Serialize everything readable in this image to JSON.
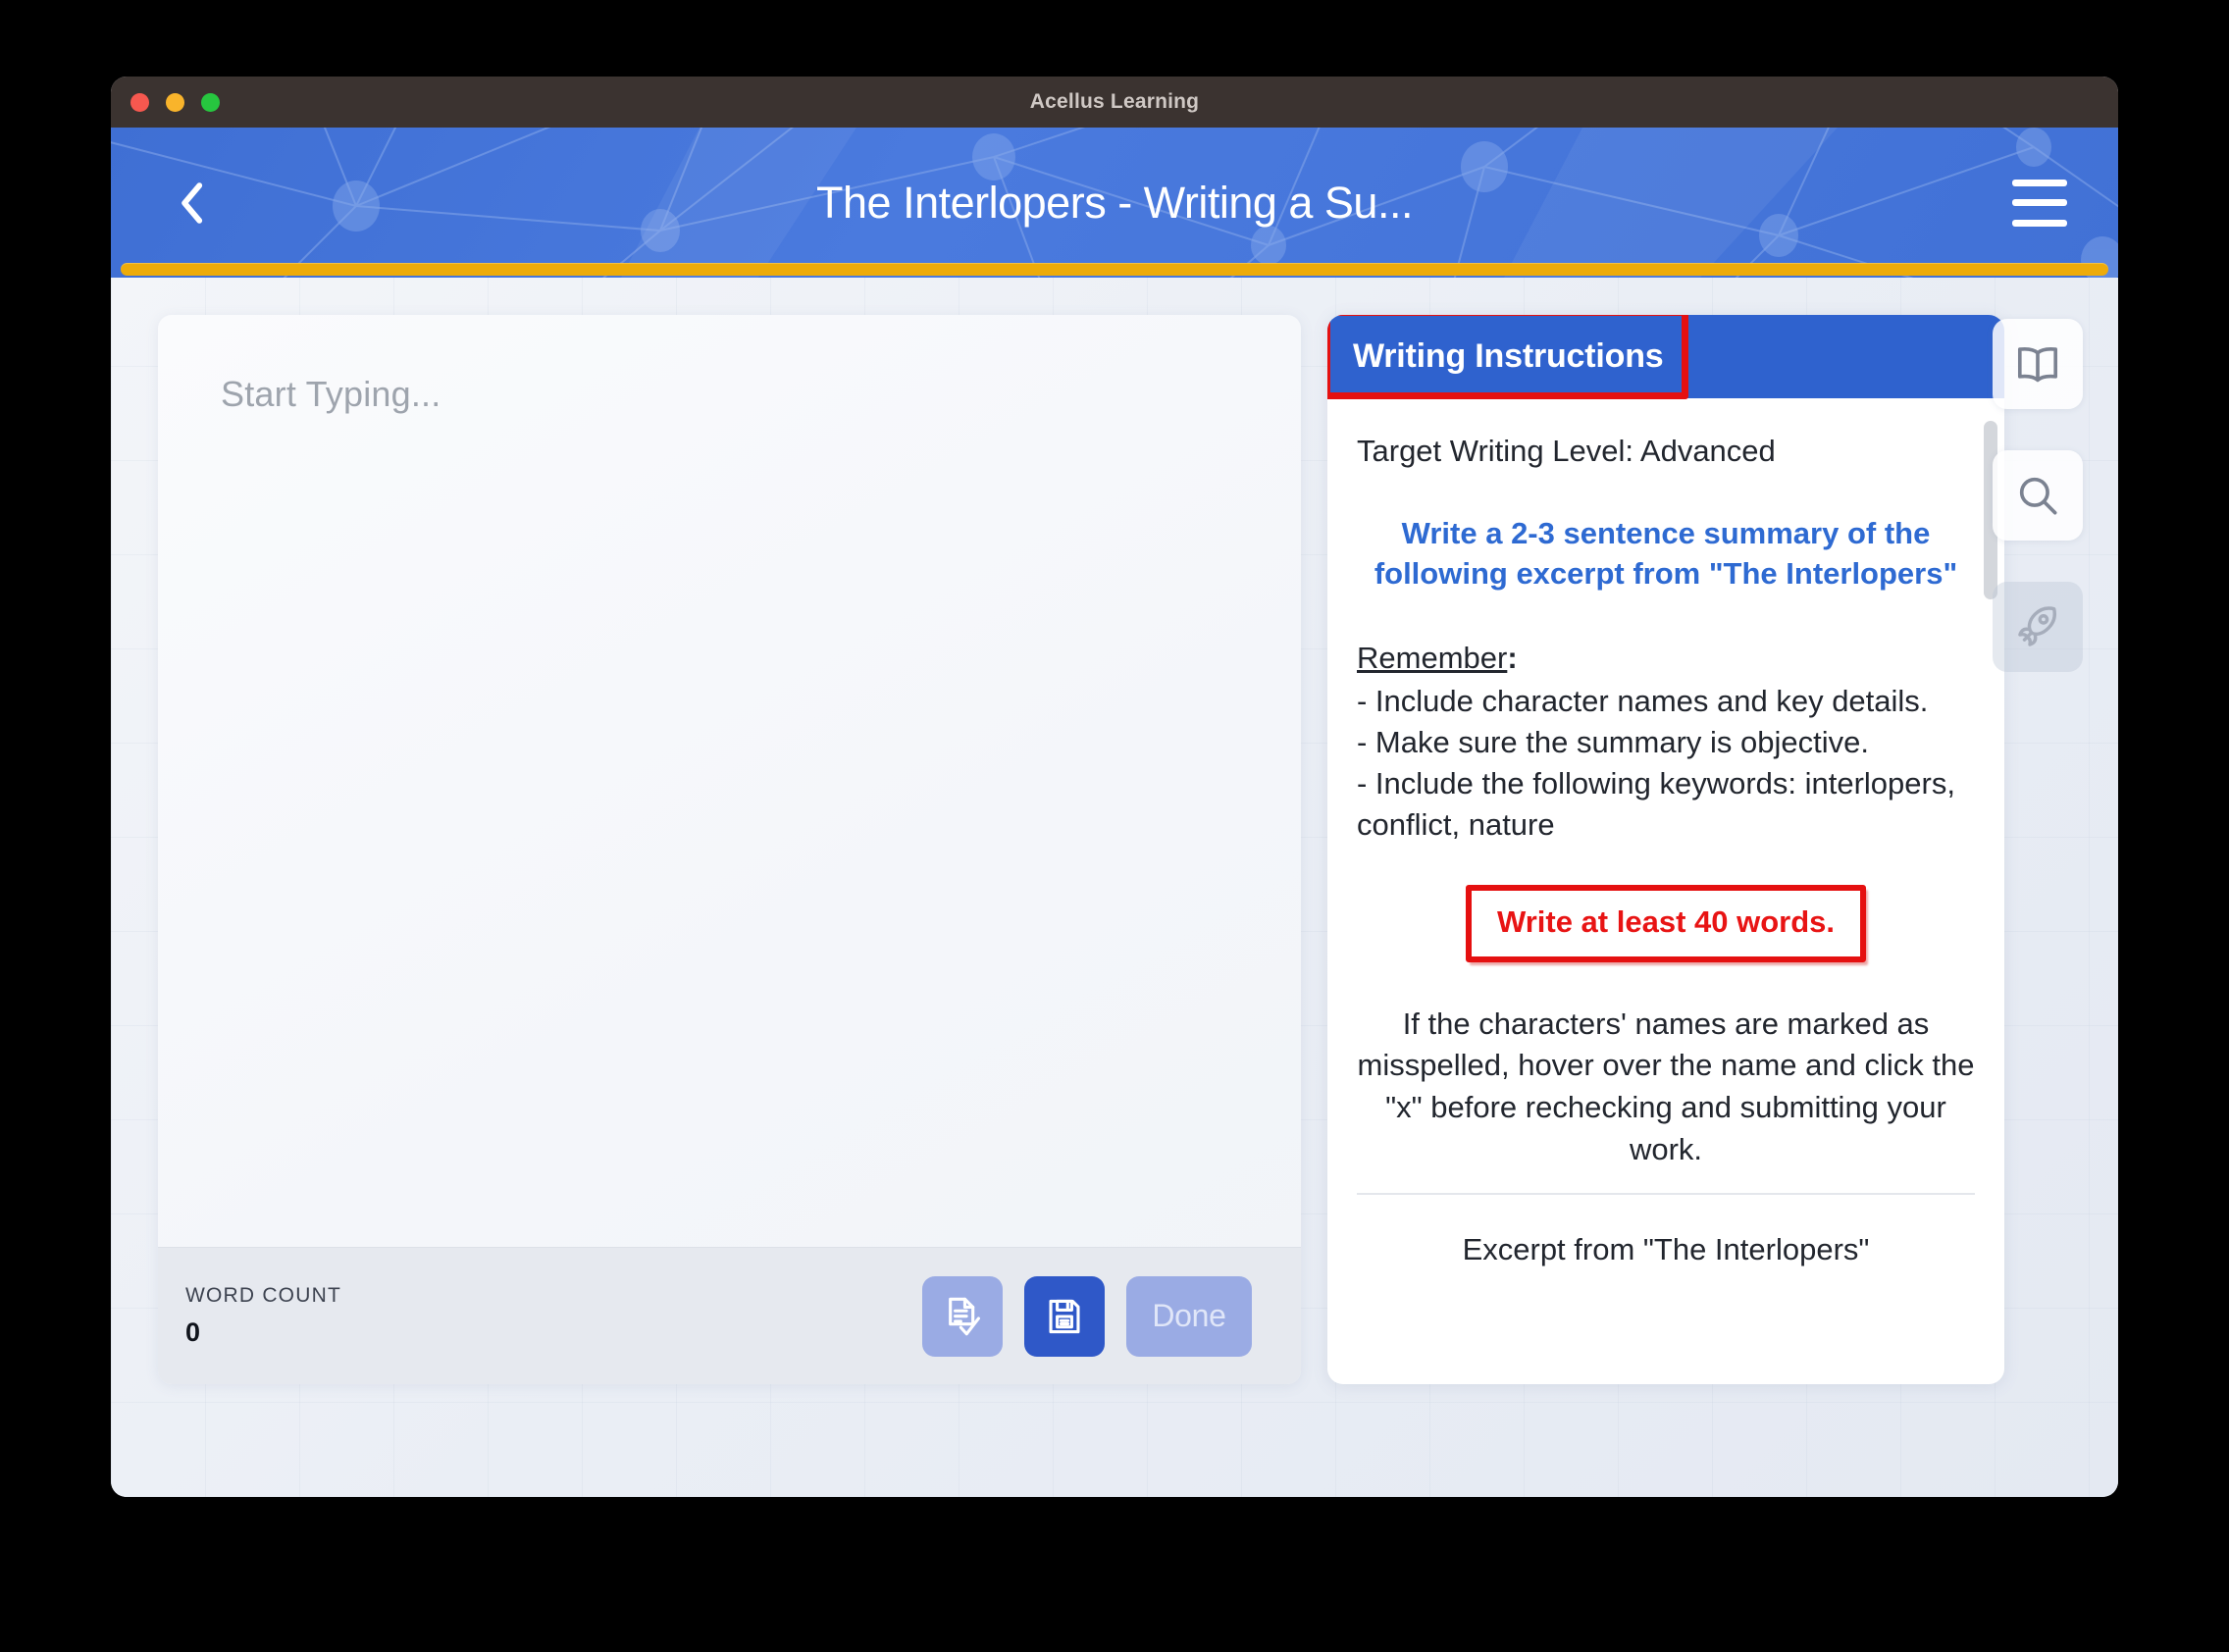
{
  "window": {
    "app_title": "Acellus Learning",
    "traffic_lights": [
      "close-red",
      "minimize-yellow",
      "maximize-green"
    ]
  },
  "header": {
    "back_icon": "chevron-left-icon",
    "title": "The Interlopers - Writing a Su...",
    "menu_icon": "hamburger-menu-icon",
    "progress_percent": 100,
    "progress_color": "#edab0a",
    "background_color": "#4171d6"
  },
  "editor": {
    "placeholder": "Start Typing...",
    "value": "",
    "toolbar": {
      "word_count_label": "WORD COUNT",
      "word_count_value": "0",
      "spellcheck_icon": "document-check-icon",
      "save_icon": "floppy-disk-save-icon",
      "done_label": "Done"
    }
  },
  "instructions": {
    "title": "Writing Instructions",
    "title_annotation_color": "#e51010",
    "header_color": "#2f62ce",
    "target_level": "Target Writing Level: Advanced",
    "prompt": "Write a 2-3 sentence summary of the following excerpt from \"The Interlopers\"",
    "remember_label": "Remember",
    "remember_colon": ":",
    "bullets": [
      "- Include character names and key details.",
      "- Make sure the summary is objective.",
      "- Include the following keywords: interlopers, conflict, nature"
    ],
    "word_requirement": "Write at least 40 words.",
    "word_requirement_color": "#e81414",
    "note": "If the characters' names are marked as misspelled, hover over the name and click the  \"x\" before rechecking and submitting your work.",
    "excerpt_heading": "Excerpt from \"The Interlopers\""
  },
  "icon_rail": [
    {
      "name": "book-icon",
      "state": "active"
    },
    {
      "name": "search-icon",
      "state": "active"
    },
    {
      "name": "rocket-icon",
      "state": "muted"
    }
  ]
}
